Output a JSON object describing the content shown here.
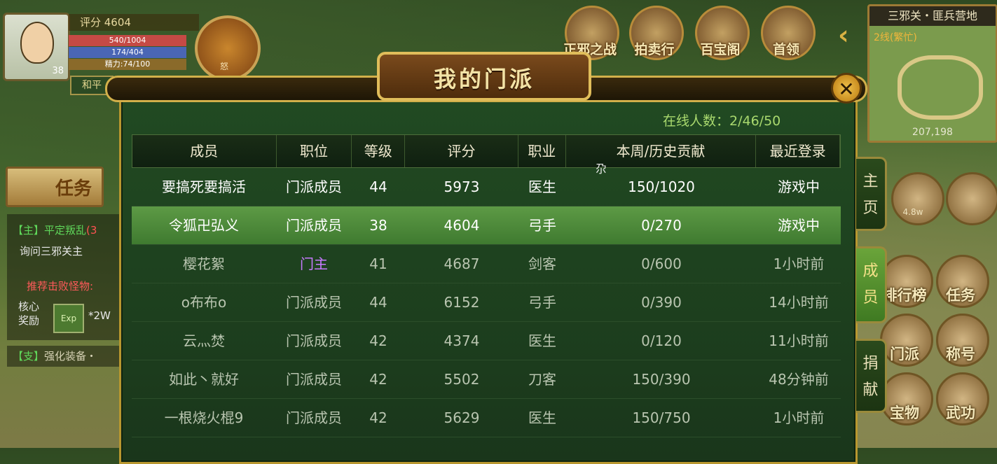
{
  "player": {
    "score": "评分 4604",
    "hp": "540/1004",
    "mp": "174/404",
    "energy": "精力:74/100",
    "level": "38",
    "mode": "和平",
    "rage_label": "怒"
  },
  "top_menu": [
    {
      "label": "正邪之战",
      "icon": "wu-battle-icon"
    },
    {
      "label": "拍卖行",
      "icon": "abacus-icon"
    },
    {
      "label": "百宝阁",
      "icon": "treasure-house-icon"
    },
    {
      "label": "首领",
      "icon": "boss-icon"
    }
  ],
  "minimap": {
    "title": "三邪关・匪兵营地",
    "line": "2线(繁忙)",
    "coords": "207,198"
  },
  "left_panel": {
    "task_button": "任务",
    "quest_main_prefix": "【主】平定叛乱",
    "quest_main_suffix": "(3",
    "quest_main_desc": "询问三邪关主",
    "quest_recommend": "推荐击败怪物:",
    "core_reward": "核心奖励",
    "exp_label": "Exp",
    "exp_amount": "*2W",
    "quest_branch_prefix": "【支】",
    "quest_branch_text": "强化装备・"
  },
  "right_icons": {
    "power": "4.8w",
    "ranking": "排行榜",
    "task": "任务",
    "sect": "门派",
    "title": "称号",
    "treasure": "宝物",
    "martial": "武功"
  },
  "dialog": {
    "title": "我的门派",
    "close": "✕",
    "online": "在线人数：2/46/50",
    "stray_glyph": "尕",
    "tabs": [
      {
        "label": "主页"
      },
      {
        "label": "成员"
      },
      {
        "label": "捐献"
      }
    ],
    "columns": [
      "成员",
      "职位",
      "等级",
      "评分",
      "职业",
      "本周/历史贡献",
      "最近登录"
    ],
    "rows": [
      [
        "要搞死要搞活",
        "门派成员",
        "44",
        "5973",
        "医生",
        "150/1020",
        "游戏中"
      ],
      [
        "令狐卍弘义",
        "门派成员",
        "38",
        "4604",
        "弓手",
        "0/270",
        "游戏中"
      ],
      [
        "樱花絮",
        "门主",
        "41",
        "4687",
        "剑客",
        "0/600",
        "1小时前"
      ],
      [
        "o布布o",
        "门派成员",
        "44",
        "6152",
        "弓手",
        "0/390",
        "14小时前"
      ],
      [
        "云灬焚",
        "门派成员",
        "42",
        "4374",
        "医生",
        "0/120",
        "11小时前"
      ],
      [
        "如此丶就好",
        "门派成员",
        "42",
        "5502",
        "刀客",
        "150/390",
        "48分钟前"
      ],
      [
        "一根烧火棍9",
        "门派成员",
        "42",
        "5629",
        "医生",
        "150/750",
        "1小时前"
      ]
    ]
  }
}
